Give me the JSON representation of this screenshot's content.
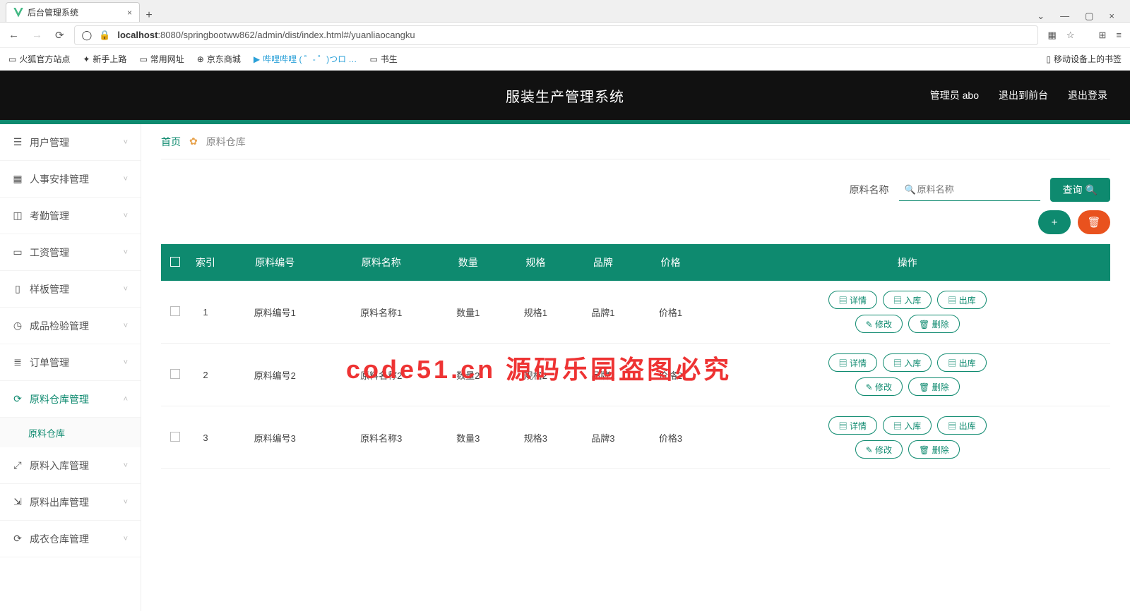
{
  "browser": {
    "tab_title": "后台管理系统",
    "url_host": "localhost",
    "url_path": ":8080/springbootww862/admin/dist/index.html#/yuanliaocangku",
    "bookmarks": [
      "火狐官方站点",
      "新手上路",
      "常用网址",
      "京东商城",
      "哔哩哔哩 ( ゜- ゜)つロ …",
      "书生"
    ],
    "bookmark_right": "移动设备上的书签"
  },
  "header": {
    "app_title": "服装生产管理系统",
    "admin_label": "管理员 abo",
    "to_front": "退出到前台",
    "logout": "退出登录"
  },
  "sidebar": {
    "items": [
      {
        "icon": "☰",
        "label": "用户管理"
      },
      {
        "icon": "▦",
        "label": "人事安排管理"
      },
      {
        "icon": "◫",
        "label": "考勤管理"
      },
      {
        "icon": "▭",
        "label": "工资管理"
      },
      {
        "icon": "▯",
        "label": "样板管理"
      },
      {
        "icon": "◷",
        "label": "成品检验管理"
      },
      {
        "icon": "≣",
        "label": "订单管理"
      },
      {
        "icon": "⟳",
        "label": "原料仓库管理",
        "expanded": true,
        "sub": "原料仓库"
      },
      {
        "icon": "⤢",
        "label": "原料入库管理"
      },
      {
        "icon": "⇲",
        "label": "原料出库管理"
      },
      {
        "icon": "⟳",
        "label": "成衣仓库管理"
      }
    ]
  },
  "breadcrumb": {
    "home": "首页",
    "current": "原料仓库"
  },
  "search": {
    "label": "原料名称",
    "placeholder": "原料名称",
    "query_btn": "查询"
  },
  "table": {
    "headers": [
      "",
      "索引",
      "原料编号",
      "原料名称",
      "数量",
      "规格",
      "品牌",
      "价格",
      "操作"
    ],
    "ops": {
      "detail": "详情",
      "in": "入库",
      "out": "出库",
      "edit": "修改",
      "del": "删除"
    },
    "rows": [
      {
        "idx": "1",
        "code": "原料编号1",
        "name": "原料名称1",
        "qty": "数量1",
        "spec": "规格1",
        "brand": "品牌1",
        "price": "价格1"
      },
      {
        "idx": "2",
        "code": "原料编号2",
        "name": "原料名称2",
        "qty": "数量2",
        "spec": "规格2",
        "brand": "品牌2",
        "price": "价格2"
      },
      {
        "idx": "3",
        "code": "原料编号3",
        "name": "原料名称3",
        "qty": "数量3",
        "spec": "规格3",
        "brand": "品牌3",
        "price": "价格3"
      }
    ]
  },
  "watermark_big": "code51.cn 源码乐园盗图必究",
  "watermark_small": "code51.cn"
}
